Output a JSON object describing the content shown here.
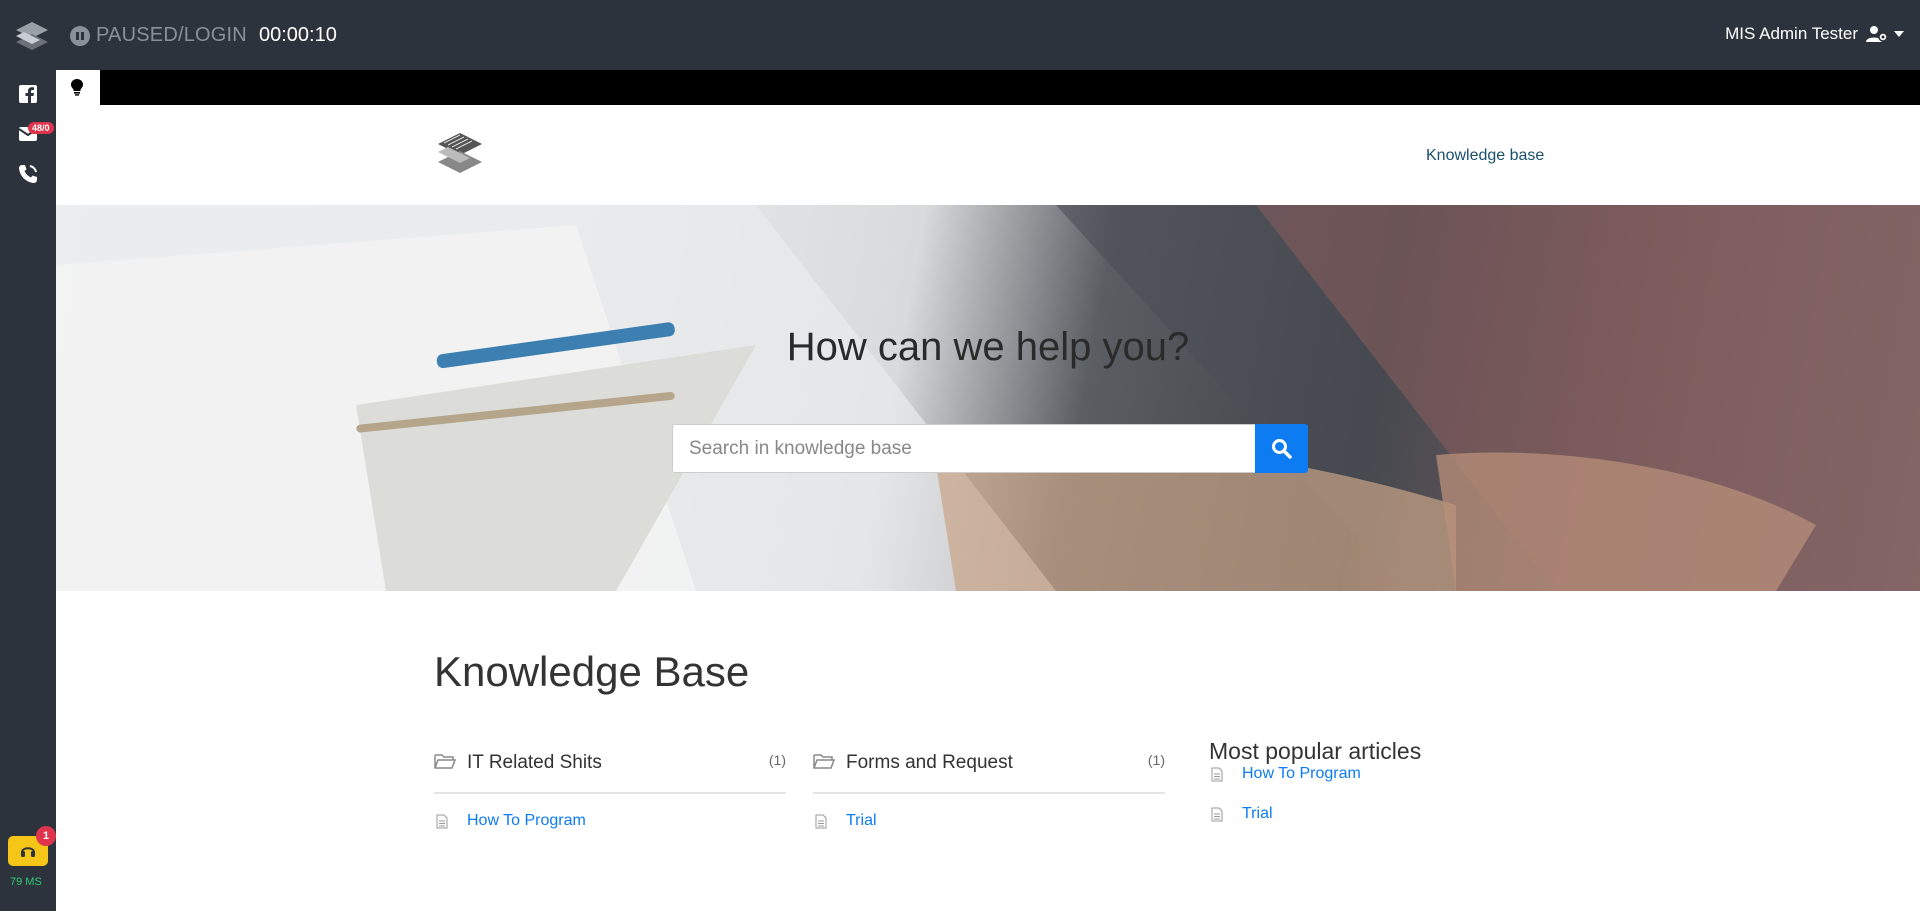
{
  "topbar": {
    "status_text": "PAUSED/LOGIN",
    "timer": "00:00:10",
    "user_name": "MIS Admin Tester"
  },
  "rail": {
    "mail_badge": "48/0",
    "agent_badge": "1",
    "latency": "79 MS",
    "icons": [
      "facebook-icon",
      "mail-icon",
      "phone-icon",
      "headset-icon"
    ]
  },
  "kb_header": {
    "nav_link": "Knowledge base"
  },
  "hero": {
    "title": "How can we help you?",
    "search_placeholder": "Search in knowledge base"
  },
  "main": {
    "title": "Knowledge Base",
    "categories": [
      {
        "name": "IT Related Shits",
        "count": "(1)",
        "articles": [
          "How To Program"
        ]
      },
      {
        "name": "Forms and Request",
        "count": "(1)",
        "articles": [
          "Trial"
        ]
      }
    ],
    "popular": {
      "title": "Most popular articles",
      "articles": [
        "How To Program",
        "Trial"
      ]
    }
  },
  "colors": {
    "topbar_bg": "#2d333d",
    "accent_blue": "#0d7cf2",
    "badge_red": "#e0344c",
    "agent_yellow": "#f5c518",
    "latency_green": "#2ecc71"
  }
}
